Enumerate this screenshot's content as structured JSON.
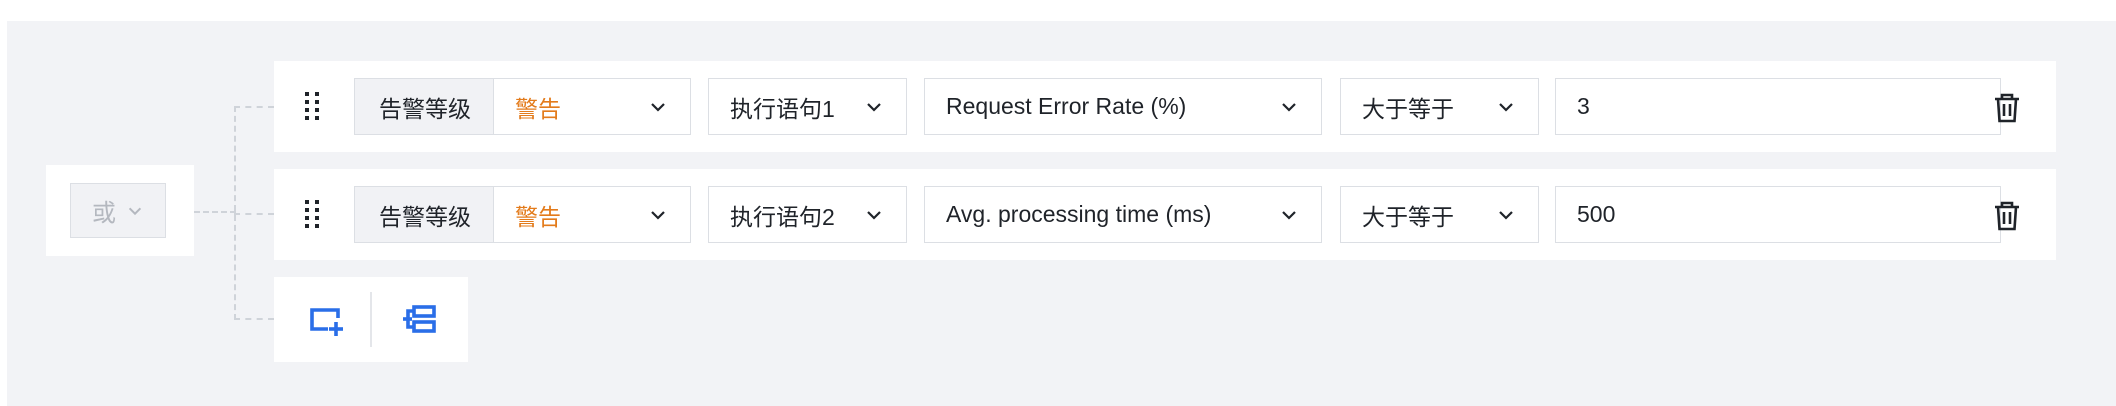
{
  "group": {
    "operator": "或"
  },
  "rows": [
    {
      "prefix": "告警等级",
      "level": "警告",
      "statement": "执行语句1",
      "metric": "Request Error Rate (%)",
      "comparator": "大于等于",
      "value": "3"
    },
    {
      "prefix": "告警等级",
      "level": "警告",
      "statement": "执行语句2",
      "metric": "Avg. processing time (ms)",
      "comparator": "大于等于",
      "value": "500"
    }
  ],
  "icons": {
    "drag": "drag-handle-icon",
    "delete": "trash-icon",
    "add_condition": "add-condition-icon",
    "add_group": "add-group-icon",
    "chevron": "chevron-down-icon"
  },
  "colors": {
    "panel_bg": "#f2f3f6",
    "level_text": "#e37b1b",
    "accent_blue": "#2a6ee8",
    "border": "#dcdfe4"
  }
}
